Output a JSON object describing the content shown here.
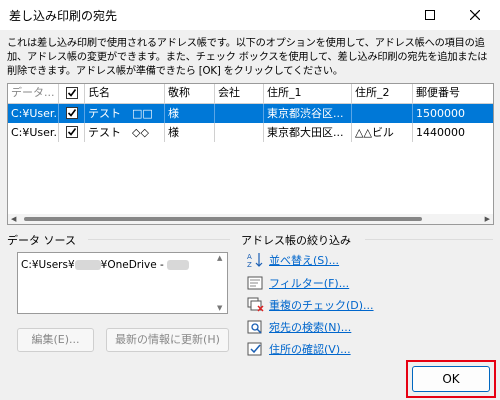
{
  "window": {
    "title": "差し込み印刷の宛先"
  },
  "description": "これは差し込み印刷で使用されるアドレス帳です。以下のオプションを使用して、アドレス帳への項目の追加、アドレス帳の変更ができます。また、チェック ボックスを使用して、差し込み印刷の宛先を追加または削除できます。アドレス帳が準備できたら [OK] をクリックしてください。",
  "table": {
    "headers": [
      "データ...",
      "",
      "氏名",
      "敬称",
      "会社",
      "住所_1",
      "住所_2",
      "郵便番号"
    ],
    "rows": [
      {
        "source": "C:¥User...",
        "checked": true,
        "name": "テスト　□□",
        "title": "様",
        "company": "",
        "address1": "東京都渋谷区...",
        "address2": "",
        "zip": "1500000",
        "selected": true
      },
      {
        "source": "C:¥User...",
        "checked": true,
        "name": "テスト　◇◇",
        "title": "様",
        "company": "",
        "address1": "東京都大田区...",
        "address2": "△△ビル",
        "zip": "1440000",
        "selected": false
      }
    ]
  },
  "data_source": {
    "label": "データ ソース",
    "item_prefix": "C:¥Users¥",
    "item_middle": "¥OneDrive - ",
    "edit_button": "編集(E)...",
    "refresh_button": "最新の情報に更新(H)"
  },
  "refine": {
    "label": "アドレス帳の絞り込み",
    "links": [
      {
        "label": "並べ替え(S)...",
        "icon": "sort-icon"
      },
      {
        "label": "フィルター(F)...",
        "icon": "filter-icon"
      },
      {
        "label": "重複のチェック(D)...",
        "icon": "duplicate-check-icon"
      },
      {
        "label": "宛先の検索(N)...",
        "icon": "find-recipient-icon"
      },
      {
        "label": "住所の確認(V)...",
        "icon": "validate-address-icon"
      }
    ]
  },
  "ok_button": "OK",
  "colors": {
    "selection": "#0078d7",
    "link": "#0066cc",
    "highlight": "#e60012"
  }
}
